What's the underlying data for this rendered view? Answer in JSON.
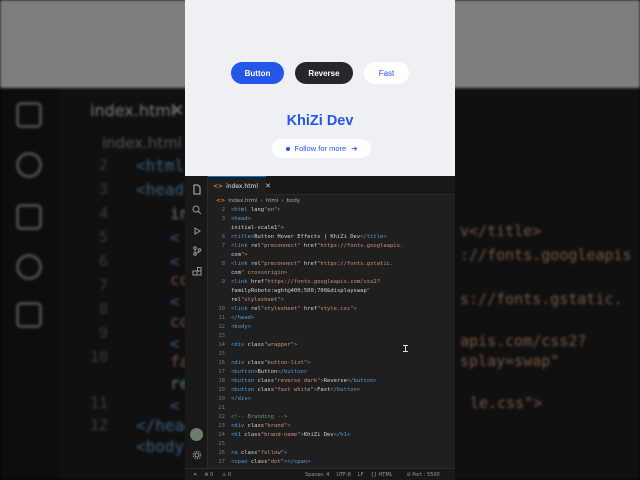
{
  "preview": {
    "buttons": [
      "Button",
      "Reverse",
      "Fast"
    ],
    "brand": "KhiZi Dev",
    "follow": "Follow for more"
  },
  "background": {
    "tab_label": "index.html",
    "crumb": "index.html",
    "line_numbers": [
      "2",
      "3",
      "4",
      "5",
      "6",
      "7",
      "8",
      "9",
      "10",
      "11",
      "12",
      "13"
    ],
    "code_fragments": [
      "<html",
      "<head",
      "in",
      "<",
      "<",
      "co",
      "<",
      "co",
      "<",
      "fa",
      "re",
      "<",
      "</head",
      "<body"
    ],
    "right_fragments": [
      "v</title>",
      "://fonts.googleapis",
      "s://fonts.gstatic.",
      "apis.com/css2?",
      "splay=swap\"",
      "le.css\">"
    ]
  },
  "editor": {
    "tab": "index.html",
    "breadcrumb": [
      "index.html",
      "html",
      "body"
    ],
    "lines": [
      {
        "n": "2",
        "text": "<html lang=\"en\">"
      },
      {
        "n": "3",
        "text": "<head>"
      },
      {
        "n": "",
        "text": "    initial-scale=1\">"
      },
      {
        "n": "6",
        "text": "    <title>Button Hover Effects | KhiZi Dev</title>"
      },
      {
        "n": "7",
        "text": "    <link rel=\"preconnect\" href=\"https://fonts.googleapis."
      },
      {
        "n": "",
        "text": "    com\">"
      },
      {
        "n": "8",
        "text": "    <link rel=\"preconnect\" href=\"https://fonts.gstatic."
      },
      {
        "n": "",
        "text": "    com\" crossorigin>"
      },
      {
        "n": "9",
        "text": "    <link href=\"https://fonts.googleapis.com/css2?"
      },
      {
        "n": "",
        "text": "    family=Roboto:wght@400;500;700&display=swap\""
      },
      {
        "n": "",
        "text": "    rel=\"stylesheet\">"
      },
      {
        "n": "10",
        "text": "    <link rel=\"stylesheet\" href=\"style.css\">"
      },
      {
        "n": "11",
        "text": "</head>"
      },
      {
        "n": "12",
        "text": "<body>"
      },
      {
        "n": "13",
        "text": ""
      },
      {
        "n": "14",
        "text": "    <div class=\"wrapper\">"
      },
      {
        "n": "15",
        "text": ""
      },
      {
        "n": "16",
        "text": "        <div class=\"button-list\">"
      },
      {
        "n": "17",
        "text": "            <button>Button</button>"
      },
      {
        "n": "18",
        "text": "            <button class=\"reverse dark\">Reverse</button>"
      },
      {
        "n": "19",
        "text": "            <button class=\"fast white\">Fast</button>"
      },
      {
        "n": "20",
        "text": "        </div>"
      },
      {
        "n": "21",
        "text": ""
      },
      {
        "n": "22",
        "text": "        <!-- Branding -->"
      },
      {
        "n": "23",
        "text": "        <div class=\"brand\">"
      },
      {
        "n": "24",
        "text": "            <h1 class=\"brand-name\">KhiZi Dev</h1>"
      },
      {
        "n": "25",
        "text": ""
      },
      {
        "n": "26",
        "text": "            <a class=\"follow\">"
      },
      {
        "n": "27",
        "text": "                <span class=\"dot\"></span>"
      }
    ]
  },
  "statusbar": {
    "problems": "0",
    "warnings": "0",
    "spaces": "Spaces: 4",
    "encoding": "UTF-8",
    "eol": "LF",
    "language": "HTML",
    "port": "Port : 5500"
  },
  "colors": {
    "accent": "#2456e8",
    "dark_button": "#25272c",
    "editor_bg": "#1f1f1f",
    "tag": "#569cd6",
    "string": "#ce9178",
    "comment": "#6a9955"
  }
}
